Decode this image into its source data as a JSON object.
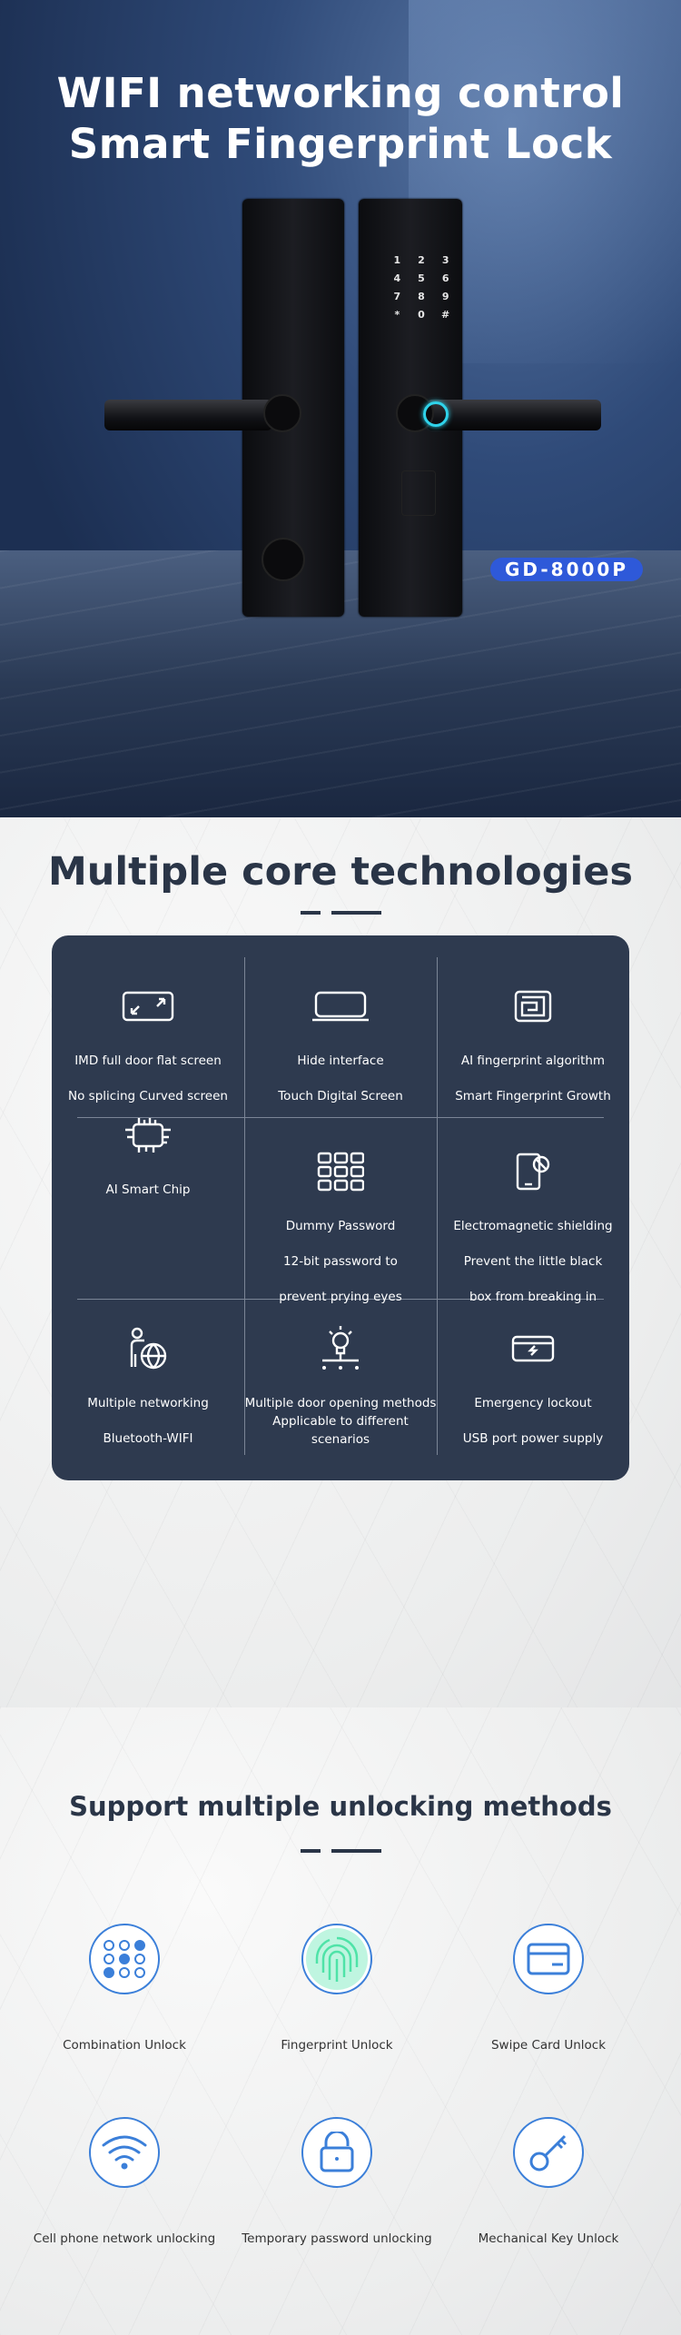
{
  "hero": {
    "title_line1": "WIFI networking control",
    "title_line2": "Smart Fingerprint Lock",
    "model_badge": "GD-8000P",
    "keypad": [
      "1",
      "2",
      "3",
      "4",
      "5",
      "6",
      "7",
      "8",
      "9",
      "*",
      "0",
      "#"
    ],
    "badge_color": "#2e59d9"
  },
  "core": {
    "title": "Multiple core technologies",
    "card_color": "#2e3a4f",
    "items": [
      {
        "icon": "expand-screen-icon",
        "lines": [
          "IMD full door flat screen",
          "No splicing Curved screen"
        ]
      },
      {
        "icon": "laptop-icon",
        "lines": [
          "Hide interface",
          "Touch Digital Screen"
        ]
      },
      {
        "icon": "maze-fingerprint-icon",
        "lines": [
          "AI fingerprint algorithm",
          "Smart Fingerprint Growth"
        ]
      },
      {
        "icon": "chip-icon",
        "lines": [
          "AI Smart Chip"
        ]
      },
      {
        "icon": "keypad-grid-icon",
        "lines": [
          "Dummy Password",
          "12-bit password to",
          "prevent prying eyes"
        ]
      },
      {
        "icon": "phone-shield-icon",
        "lines": [
          "Electromagnetic shielding",
          "Prevent the little black",
          "box from breaking in"
        ]
      },
      {
        "icon": "person-globe-icon",
        "lines": [
          "Multiple networking",
          "Bluetooth-WIFI"
        ]
      },
      {
        "icon": "lightbulb-network-icon",
        "lines": [
          "Multiple door opening methods",
          "Applicable to different scenarios"
        ]
      },
      {
        "icon": "usb-power-icon",
        "lines": [
          "Emergency lockout",
          "USB port power supply"
        ]
      }
    ]
  },
  "unlock": {
    "title": "Support multiple unlocking methods",
    "accent": "#3b7fd9",
    "methods": [
      {
        "icon": "combination-keypad-icon",
        "label": "Combination Unlock"
      },
      {
        "icon": "fingerprint-icon",
        "label": "Fingerprint Unlock"
      },
      {
        "icon": "card-icon",
        "label": "Swipe Card Unlock"
      },
      {
        "icon": "wifi-icon",
        "label": "Cell phone network unlocking"
      },
      {
        "icon": "padlock-open-icon",
        "label": "Temporary password unlocking"
      },
      {
        "icon": "key-icon",
        "label": "Mechanical Key Unlock"
      }
    ]
  }
}
